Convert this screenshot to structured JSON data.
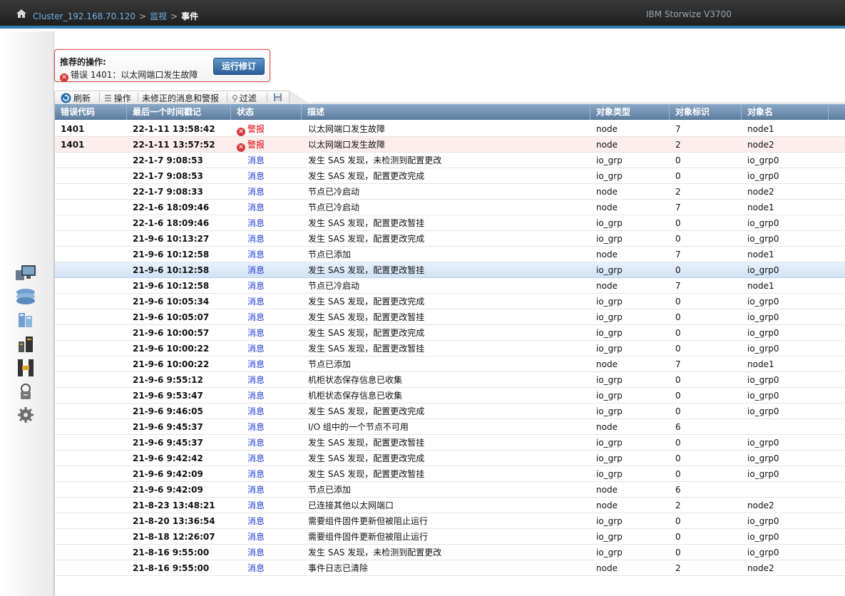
{
  "header": {
    "cluster": "Cluster_192.168.70.120",
    "sep1": ">",
    "monitor": "监视",
    "sep2": ">",
    "current": "事件",
    "product": "IBM Storwize V3700"
  },
  "recommended": {
    "title": "推荐的操作:",
    "error": "错误 1401：以太网端口发生故障",
    "button": "运行修订"
  },
  "toolbar": {
    "refresh": "刷新",
    "actions": "操作",
    "filter_view": "未修正的消息和警报",
    "filter": "过滤"
  },
  "table": {
    "columns": [
      "错误代码",
      "最后一个时间戳记",
      "状态",
      "描述",
      "对象类型",
      "对象标识",
      "对象名"
    ],
    "rows": [
      {
        "code": "1401",
        "time": "22-1-11 13:58:42",
        "status": "警报",
        "desc": "以太网端口发生故障",
        "type": "node",
        "id": "7",
        "name": "node1"
      },
      {
        "code": "1401",
        "time": "22-1-11 13:57:52",
        "status": "警报",
        "desc": "以太网端口发生故障",
        "type": "node",
        "id": "2",
        "name": "node2"
      },
      {
        "code": "",
        "time": "22-1-7 9:08:53",
        "status": "消息",
        "desc": "发生 SAS 发现，未检测到配置更改",
        "type": "io_grp",
        "id": "0",
        "name": "io_grp0"
      },
      {
        "code": "",
        "time": "22-1-7 9:08:53",
        "status": "消息",
        "desc": "发生 SAS 发现，配置更改完成",
        "type": "io_grp",
        "id": "0",
        "name": "io_grp0"
      },
      {
        "code": "",
        "time": "22-1-7 9:08:33",
        "status": "消息",
        "desc": "节点已冷启动",
        "type": "node",
        "id": "2",
        "name": "node2"
      },
      {
        "code": "",
        "time": "22-1-6 18:09:46",
        "status": "消息",
        "desc": "节点已冷启动",
        "type": "node",
        "id": "7",
        "name": "node1"
      },
      {
        "code": "",
        "time": "22-1-6 18:09:46",
        "status": "消息",
        "desc": "发生 SAS 发现，配置更改暂挂",
        "type": "io_grp",
        "id": "0",
        "name": "io_grp0"
      },
      {
        "code": "",
        "time": "21-9-6 10:13:27",
        "status": "消息",
        "desc": "发生 SAS 发现，配置更改完成",
        "type": "io_grp",
        "id": "0",
        "name": "io_grp0"
      },
      {
        "code": "",
        "time": "21-9-6 10:12:58",
        "status": "消息",
        "desc": "节点已添加",
        "type": "node",
        "id": "7",
        "name": "node1"
      },
      {
        "code": "",
        "time": "21-9-6 10:12:58",
        "status": "消息",
        "desc": "发生 SAS 发现，配置更改暂挂",
        "type": "io_grp",
        "id": "0",
        "name": "io_grp0"
      },
      {
        "code": "",
        "time": "21-9-6 10:12:58",
        "status": "消息",
        "desc": "节点已冷启动",
        "type": "node",
        "id": "7",
        "name": "node1"
      },
      {
        "code": "",
        "time": "21-9-6 10:05:34",
        "status": "消息",
        "desc": "发生 SAS 发现，配置更改完成",
        "type": "io_grp",
        "id": "0",
        "name": "io_grp0"
      },
      {
        "code": "",
        "time": "21-9-6 10:05:07",
        "status": "消息",
        "desc": "发生 SAS 发现，配置更改暂挂",
        "type": "io_grp",
        "id": "0",
        "name": "io_grp0"
      },
      {
        "code": "",
        "time": "21-9-6 10:00:57",
        "status": "消息",
        "desc": "发生 SAS 发现，配置更改完成",
        "type": "io_grp",
        "id": "0",
        "name": "io_grp0"
      },
      {
        "code": "",
        "time": "21-9-6 10:00:22",
        "status": "消息",
        "desc": "发生 SAS 发现，配置更改暂挂",
        "type": "io_grp",
        "id": "0",
        "name": "io_grp0"
      },
      {
        "code": "",
        "time": "21-9-6 10:00:22",
        "status": "消息",
        "desc": "节点已添加",
        "type": "node",
        "id": "7",
        "name": "node1"
      },
      {
        "code": "",
        "time": "21-9-6 9:55:12",
        "status": "消息",
        "desc": "机柜状态保存信息已收集",
        "type": "io_grp",
        "id": "0",
        "name": "io_grp0"
      },
      {
        "code": "",
        "time": "21-9-6 9:53:47",
        "status": "消息",
        "desc": "机柜状态保存信息已收集",
        "type": "io_grp",
        "id": "0",
        "name": "io_grp0"
      },
      {
        "code": "",
        "time": "21-9-6 9:46:05",
        "status": "消息",
        "desc": "发生 SAS 发现，配置更改完成",
        "type": "io_grp",
        "id": "0",
        "name": "io_grp0"
      },
      {
        "code": "",
        "time": "21-9-6 9:45:37",
        "status": "消息",
        "desc": "I/O 组中的一个节点不可用",
        "type": "node",
        "id": "6",
        "name": ""
      },
      {
        "code": "",
        "time": "21-9-6 9:45:37",
        "status": "消息",
        "desc": "发生 SAS 发现，配置更改暂挂",
        "type": "io_grp",
        "id": "0",
        "name": "io_grp0"
      },
      {
        "code": "",
        "time": "21-9-6 9:42:42",
        "status": "消息",
        "desc": "发生 SAS 发现，配置更改完成",
        "type": "io_grp",
        "id": "0",
        "name": "io_grp0"
      },
      {
        "code": "",
        "time": "21-9-6 9:42:09",
        "status": "消息",
        "desc": "发生 SAS 发现，配置更改暂挂",
        "type": "io_grp",
        "id": "0",
        "name": "io_grp0"
      },
      {
        "code": "",
        "time": "21-9-6 9:42:09",
        "status": "消息",
        "desc": "节点已添加",
        "type": "node",
        "id": "6",
        "name": ""
      },
      {
        "code": "",
        "time": "21-8-23 13:48:21",
        "status": "消息",
        "desc": "已连接其他以太网端口",
        "type": "node",
        "id": "2",
        "name": "node2"
      },
      {
        "code": "",
        "time": "21-8-20 13:36:54",
        "status": "消息",
        "desc": "需要组件固件更新但被阻止运行",
        "type": "io_grp",
        "id": "0",
        "name": "io_grp0"
      },
      {
        "code": "",
        "time": "21-8-18 12:26:07",
        "status": "消息",
        "desc": "需要组件固件更新但被阻止运行",
        "type": "io_grp",
        "id": "0",
        "name": "io_grp0"
      },
      {
        "code": "",
        "time": "21-8-16 9:55:00",
        "status": "消息",
        "desc": "发生 SAS 发现，未检测到配置更改",
        "type": "io_grp",
        "id": "0",
        "name": "io_grp0"
      },
      {
        "code": "",
        "time": "21-8-16 9:55:00",
        "status": "消息",
        "desc": "事件日志已清除",
        "type": "node",
        "id": "2",
        "name": "node2"
      }
    ]
  },
  "sidebar": {
    "icons": [
      "monitor-icon",
      "pools-icon",
      "volumes-icon",
      "hosts-icon",
      "copy-services-icon",
      "access-icon",
      "settings-icon"
    ]
  },
  "colors": {
    "accent": "#2c7fb0",
    "alert": "#dd0000",
    "info": "#1f3cd6",
    "header_bg": "#6f8fb2"
  }
}
